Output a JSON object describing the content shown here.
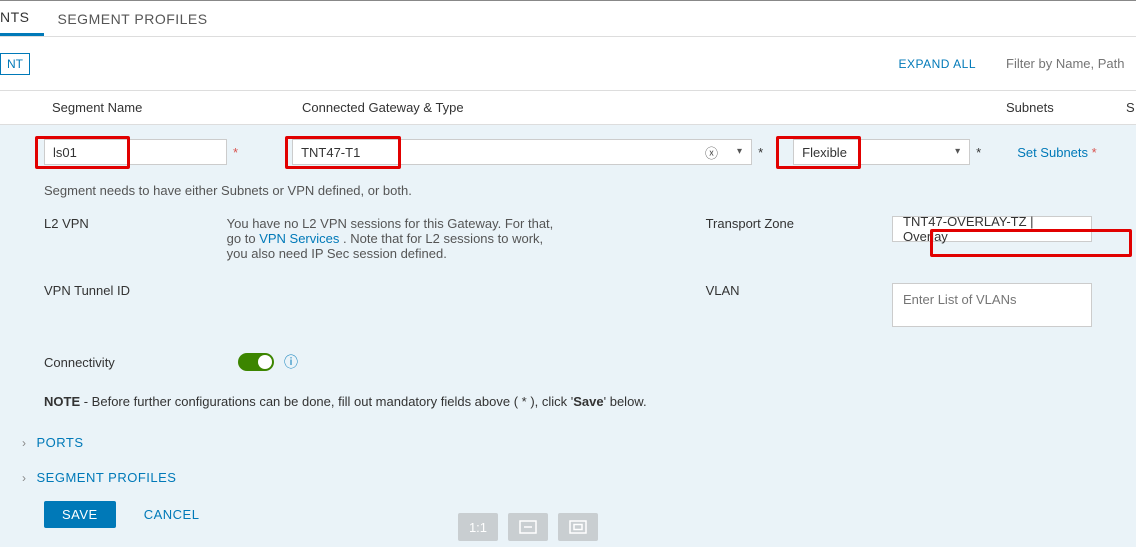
{
  "tabs": {
    "segments": "NTS",
    "profiles": "SEGMENT PROFILES"
  },
  "actionbar": {
    "add": "NT",
    "expand": "EXPAND ALL",
    "filter_placeholder": "Filter by Name, Path o"
  },
  "columns": {
    "name": "Segment Name",
    "gateway": "Connected Gateway & Type",
    "subnets": "Subnets",
    "extra": "S"
  },
  "form": {
    "segment_name": "ls01",
    "gateway": "TNT47-T1",
    "type": "Flexible",
    "set_subnets": "Set Subnets",
    "required": "*"
  },
  "details": {
    "helper": "Segment needs to have either Subnets or VPN defined, or both.",
    "l2vpn_label": "L2 VPN",
    "l2vpn_text_1": "You have no L2 VPN sessions for this Gateway. For that, go to ",
    "l2vpn_link": "VPN Services",
    "l2vpn_text_2": " . Note that for L2 sessions to work, you also need IP Sec session defined.",
    "tunnel_label": "VPN Tunnel ID",
    "connectivity_label": "Connectivity",
    "transport_label": "Transport Zone",
    "transport_value": "TNT47-OVERLAY-TZ | Overlay",
    "vlan_label": "VLAN",
    "vlan_placeholder": "Enter List of VLANs",
    "note_prefix": "NOTE",
    "note_body": " - Before further configurations can be done, fill out mandatory fields above ( * ), click '",
    "note_save": "Save",
    "note_suffix": "' below.",
    "ports": "PORTS",
    "segment_profiles": "SEGMENT PROFILES"
  },
  "buttons": {
    "save": "SAVE",
    "cancel": "CANCEL"
  },
  "icons": {
    "one_to_one": "1:1"
  }
}
